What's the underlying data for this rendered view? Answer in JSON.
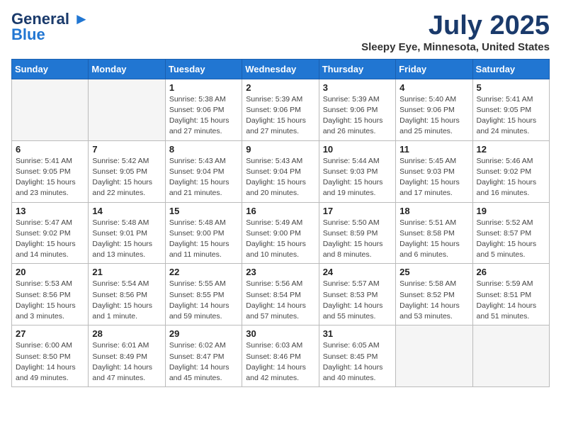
{
  "header": {
    "logo_line1": "General",
    "logo_line2": "Blue",
    "month": "July 2025",
    "location": "Sleepy Eye, Minnesota, United States"
  },
  "weekdays": [
    "Sunday",
    "Monday",
    "Tuesday",
    "Wednesday",
    "Thursday",
    "Friday",
    "Saturday"
  ],
  "weeks": [
    [
      {
        "day": "",
        "info": ""
      },
      {
        "day": "",
        "info": ""
      },
      {
        "day": "1",
        "info": "Sunrise: 5:38 AM\nSunset: 9:06 PM\nDaylight: 15 hours\nand 27 minutes."
      },
      {
        "day": "2",
        "info": "Sunrise: 5:39 AM\nSunset: 9:06 PM\nDaylight: 15 hours\nand 27 minutes."
      },
      {
        "day": "3",
        "info": "Sunrise: 5:39 AM\nSunset: 9:06 PM\nDaylight: 15 hours\nand 26 minutes."
      },
      {
        "day": "4",
        "info": "Sunrise: 5:40 AM\nSunset: 9:06 PM\nDaylight: 15 hours\nand 25 minutes."
      },
      {
        "day": "5",
        "info": "Sunrise: 5:41 AM\nSunset: 9:05 PM\nDaylight: 15 hours\nand 24 minutes."
      }
    ],
    [
      {
        "day": "6",
        "info": "Sunrise: 5:41 AM\nSunset: 9:05 PM\nDaylight: 15 hours\nand 23 minutes."
      },
      {
        "day": "7",
        "info": "Sunrise: 5:42 AM\nSunset: 9:05 PM\nDaylight: 15 hours\nand 22 minutes."
      },
      {
        "day": "8",
        "info": "Sunrise: 5:43 AM\nSunset: 9:04 PM\nDaylight: 15 hours\nand 21 minutes."
      },
      {
        "day": "9",
        "info": "Sunrise: 5:43 AM\nSunset: 9:04 PM\nDaylight: 15 hours\nand 20 minutes."
      },
      {
        "day": "10",
        "info": "Sunrise: 5:44 AM\nSunset: 9:03 PM\nDaylight: 15 hours\nand 19 minutes."
      },
      {
        "day": "11",
        "info": "Sunrise: 5:45 AM\nSunset: 9:03 PM\nDaylight: 15 hours\nand 17 minutes."
      },
      {
        "day": "12",
        "info": "Sunrise: 5:46 AM\nSunset: 9:02 PM\nDaylight: 15 hours\nand 16 minutes."
      }
    ],
    [
      {
        "day": "13",
        "info": "Sunrise: 5:47 AM\nSunset: 9:02 PM\nDaylight: 15 hours\nand 14 minutes."
      },
      {
        "day": "14",
        "info": "Sunrise: 5:48 AM\nSunset: 9:01 PM\nDaylight: 15 hours\nand 13 minutes."
      },
      {
        "day": "15",
        "info": "Sunrise: 5:48 AM\nSunset: 9:00 PM\nDaylight: 15 hours\nand 11 minutes."
      },
      {
        "day": "16",
        "info": "Sunrise: 5:49 AM\nSunset: 9:00 PM\nDaylight: 15 hours\nand 10 minutes."
      },
      {
        "day": "17",
        "info": "Sunrise: 5:50 AM\nSunset: 8:59 PM\nDaylight: 15 hours\nand 8 minutes."
      },
      {
        "day": "18",
        "info": "Sunrise: 5:51 AM\nSunset: 8:58 PM\nDaylight: 15 hours\nand 6 minutes."
      },
      {
        "day": "19",
        "info": "Sunrise: 5:52 AM\nSunset: 8:57 PM\nDaylight: 15 hours\nand 5 minutes."
      }
    ],
    [
      {
        "day": "20",
        "info": "Sunrise: 5:53 AM\nSunset: 8:56 PM\nDaylight: 15 hours\nand 3 minutes."
      },
      {
        "day": "21",
        "info": "Sunrise: 5:54 AM\nSunset: 8:56 PM\nDaylight: 15 hours\nand 1 minute."
      },
      {
        "day": "22",
        "info": "Sunrise: 5:55 AM\nSunset: 8:55 PM\nDaylight: 14 hours\nand 59 minutes."
      },
      {
        "day": "23",
        "info": "Sunrise: 5:56 AM\nSunset: 8:54 PM\nDaylight: 14 hours\nand 57 minutes."
      },
      {
        "day": "24",
        "info": "Sunrise: 5:57 AM\nSunset: 8:53 PM\nDaylight: 14 hours\nand 55 minutes."
      },
      {
        "day": "25",
        "info": "Sunrise: 5:58 AM\nSunset: 8:52 PM\nDaylight: 14 hours\nand 53 minutes."
      },
      {
        "day": "26",
        "info": "Sunrise: 5:59 AM\nSunset: 8:51 PM\nDaylight: 14 hours\nand 51 minutes."
      }
    ],
    [
      {
        "day": "27",
        "info": "Sunrise: 6:00 AM\nSunset: 8:50 PM\nDaylight: 14 hours\nand 49 minutes."
      },
      {
        "day": "28",
        "info": "Sunrise: 6:01 AM\nSunset: 8:49 PM\nDaylight: 14 hours\nand 47 minutes."
      },
      {
        "day": "29",
        "info": "Sunrise: 6:02 AM\nSunset: 8:47 PM\nDaylight: 14 hours\nand 45 minutes."
      },
      {
        "day": "30",
        "info": "Sunrise: 6:03 AM\nSunset: 8:46 PM\nDaylight: 14 hours\nand 42 minutes."
      },
      {
        "day": "31",
        "info": "Sunrise: 6:05 AM\nSunset: 8:45 PM\nDaylight: 14 hours\nand 40 minutes."
      },
      {
        "day": "",
        "info": ""
      },
      {
        "day": "",
        "info": ""
      }
    ]
  ]
}
